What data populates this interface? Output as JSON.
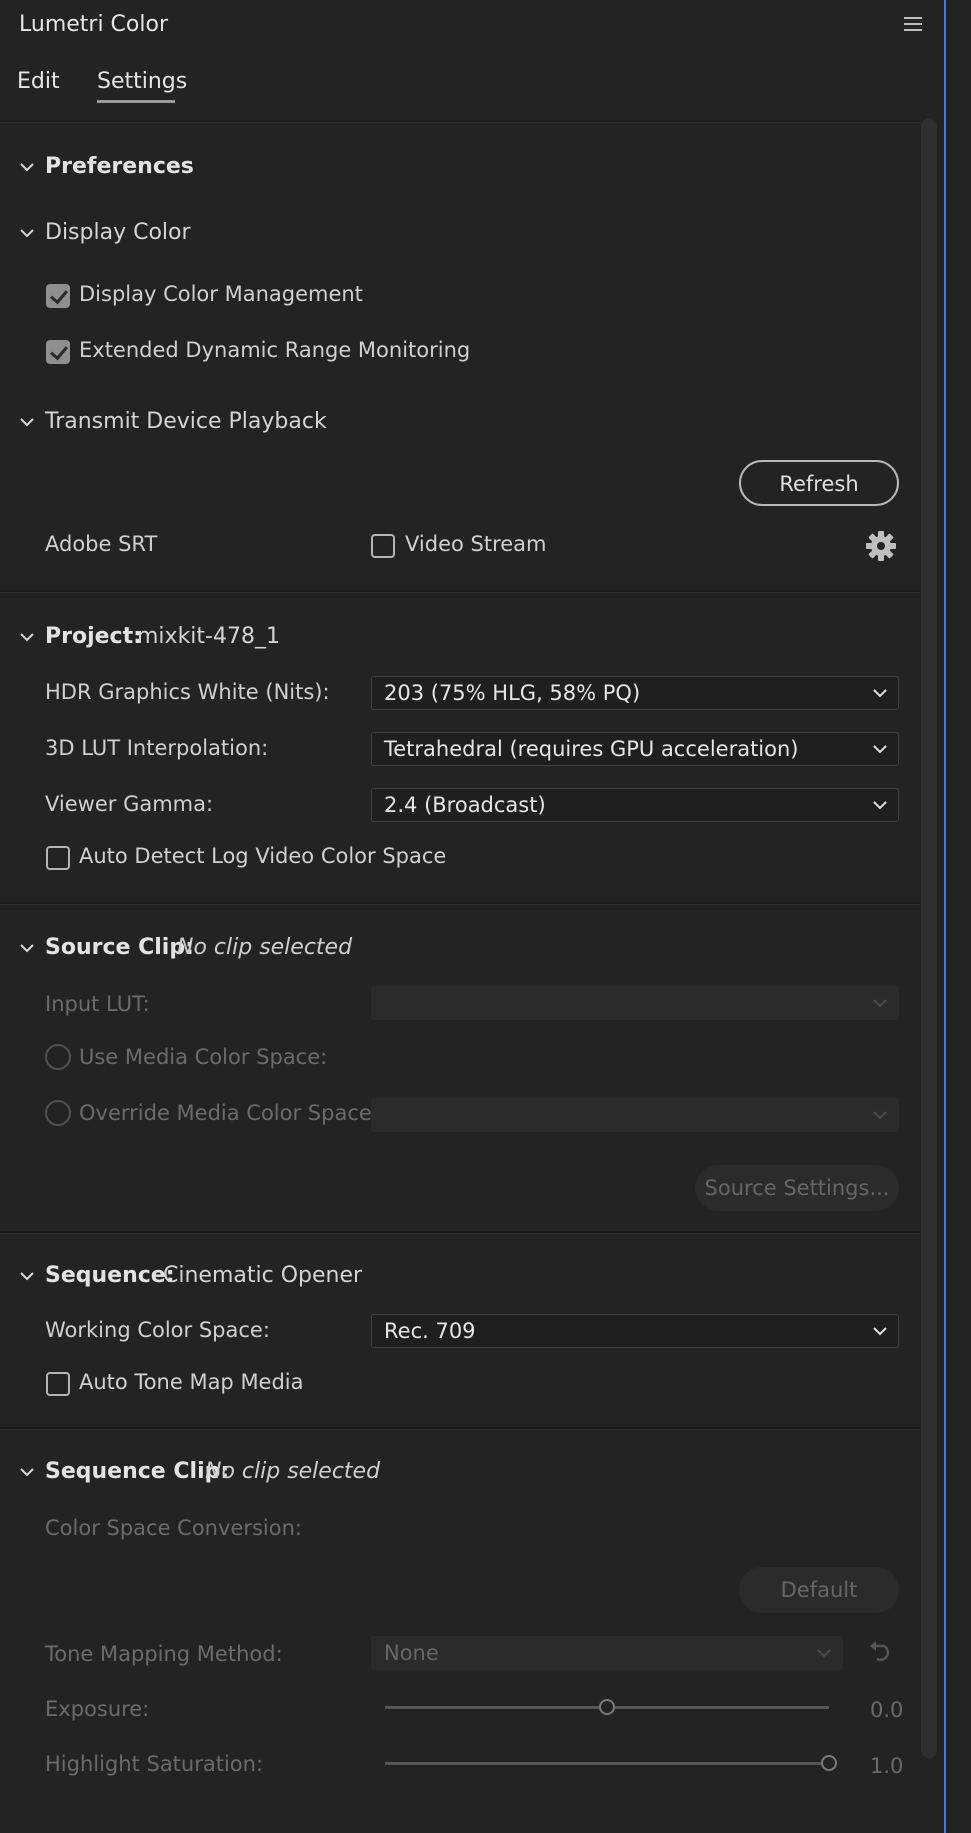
{
  "panel": {
    "title": "Lumetri Color"
  },
  "tabs": [
    {
      "label": "Edit"
    },
    {
      "label": "Settings"
    }
  ],
  "preferences": {
    "title": "Preferences",
    "display_color": {
      "title": "Display Color",
      "display_color_management": {
        "label": "Display Color Management",
        "checked": true
      },
      "edr_monitoring": {
        "label": "Extended Dynamic Range Monitoring",
        "checked": true
      }
    },
    "transmit": {
      "title": "Transmit Device Playback",
      "refresh_label": "Refresh",
      "adobe_srt_label": "Adobe SRT",
      "video_stream": {
        "label": "Video Stream",
        "checked": false
      }
    }
  },
  "project": {
    "title": "Project:",
    "name": "mixkit-478_1",
    "hdr_white": {
      "label": "HDR Graphics White (Nits):",
      "value": "203 (75% HLG, 58% PQ)"
    },
    "lut_interp": {
      "label": "3D LUT Interpolation:",
      "value": "Tetrahedral (requires GPU acceleration)"
    },
    "viewer_gamma": {
      "label": "Viewer Gamma:",
      "value": "2.4 (Broadcast)"
    },
    "auto_detect_log": {
      "label": "Auto Detect Log Video Color Space",
      "checked": false
    }
  },
  "source_clip": {
    "title": "Source Clip:",
    "status": "No clip selected",
    "input_lut": {
      "label": "Input LUT:",
      "value": ""
    },
    "use_media_cs": {
      "label": "Use Media Color Space:"
    },
    "override_media_cs": {
      "label": "Override Media Color Space:",
      "value": ""
    },
    "source_settings_label": "Source Settings..."
  },
  "sequence": {
    "title": "Sequence:",
    "name": "Cinematic Opener",
    "working_cs": {
      "label": "Working Color Space:",
      "value": "Rec. 709"
    },
    "auto_tone_map": {
      "label": "Auto Tone Map Media",
      "checked": false
    }
  },
  "sequence_clip": {
    "title": "Sequence Clip:",
    "status": "No clip selected",
    "cs_conversion_label": "Color Space Conversion:",
    "default_label": "Default",
    "tone_mapping": {
      "label": "Tone Mapping Method:",
      "value": "None"
    },
    "exposure": {
      "label": "Exposure:",
      "value": "0.0",
      "position": 0.5
    },
    "highlight_sat": {
      "label": "Highlight Saturation:",
      "value": "1.0",
      "position": 1.0
    }
  },
  "colors": {
    "accent": "#3f7ce8",
    "background": "#232323"
  }
}
